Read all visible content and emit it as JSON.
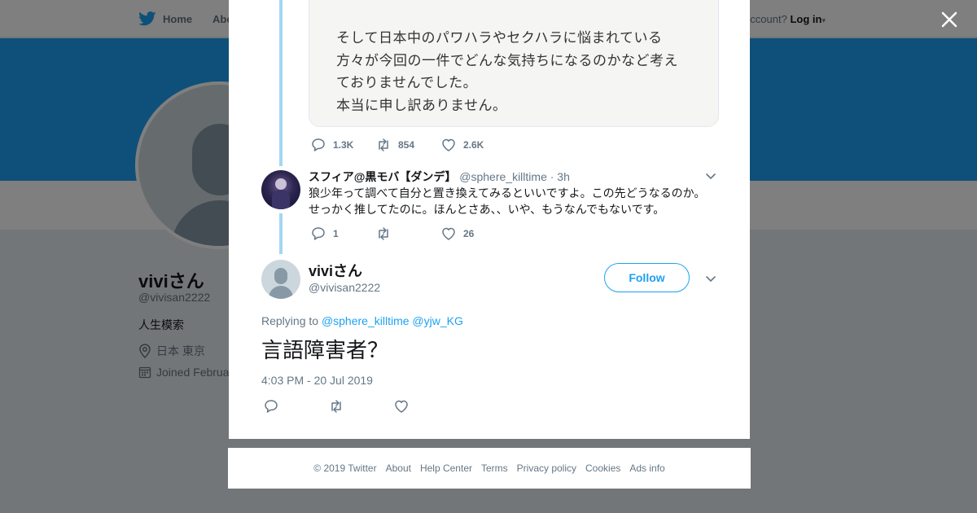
{
  "nav": {
    "home_label": "Home",
    "about_label": "Abo",
    "account_prompt": "ccount?",
    "login_label": "Log in"
  },
  "profile": {
    "name": "viviさん",
    "handle": "@vivisan2222",
    "bio": "人生模索",
    "location": "日本 東京",
    "joined": "Joined Februa"
  },
  "quoted_image_text": [
    "そして日本中のパワハラやセクハラに悩まれている",
    "方々が今回の一件でどんな気持ちになるのかなど考え",
    "ておりませんでした。",
    "本当に申し訳ありません。"
  ],
  "first_tweet_stats": {
    "replies": "1.3K",
    "retweets": "854",
    "likes": "2.6K"
  },
  "reply_tweet": {
    "name": "スフィア@黒モバ【ダンデ】",
    "handle": "@sphere_killtime",
    "time": "· 3h",
    "text_lines": [
      "狼少年って調べて自分と置き換えてみるといいですよ。この先どうなるのか。",
      "せっかく推してたのに。ほんとさあ、、いや、もうなんでもないです。"
    ],
    "replies": "1",
    "retweets": "",
    "likes": "26"
  },
  "main_tweet": {
    "name": "viviさん",
    "handle": "@vivisan2222",
    "follow_label": "Follow",
    "replying_prefix": "Replying to",
    "reply_to_1": "@sphere_killtime",
    "reply_to_2": "@yjw_KG",
    "text": "言語障害者？",
    "timestamp": "4:03 PM - 20 Jul 2019"
  },
  "footer": {
    "copyright": "© 2019 Twitter",
    "links": [
      "About",
      "Help Center",
      "Terms",
      "Privacy policy",
      "Cookies",
      "Ads info"
    ]
  },
  "colors": {
    "brand_blue": "#1da1f2",
    "thread_line": "#a3d6f4",
    "muted_text": "#657786"
  }
}
